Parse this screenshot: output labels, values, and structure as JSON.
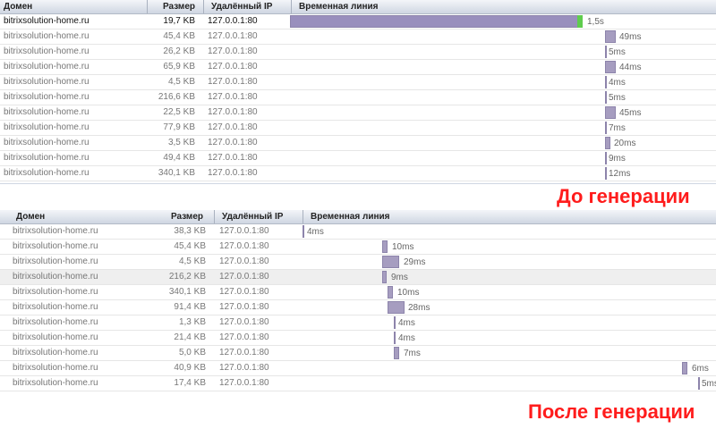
{
  "panel_before": {
    "headers": {
      "domain": "Домен",
      "size": "Размер",
      "ip": "Удалённый IP",
      "timeline": "Временная линия"
    },
    "rows": [
      {
        "domain": "bitrixsolution-home.ru",
        "size": "19,7 KB",
        "ip": "127.0.0.1:80",
        "time": "1,5s"
      },
      {
        "domain": "bitrixsolution-home.ru",
        "size": "45,4 KB",
        "ip": "127.0.0.1:80",
        "time": "49ms"
      },
      {
        "domain": "bitrixsolution-home.ru",
        "size": "26,2 KB",
        "ip": "127.0.0.1:80",
        "time": "5ms"
      },
      {
        "domain": "bitrixsolution-home.ru",
        "size": "65,9 KB",
        "ip": "127.0.0.1:80",
        "time": "44ms"
      },
      {
        "domain": "bitrixsolution-home.ru",
        "size": "4,5 KB",
        "ip": "127.0.0.1:80",
        "time": "4ms"
      },
      {
        "domain": "bitrixsolution-home.ru",
        "size": "216,6 KB",
        "ip": "127.0.0.1:80",
        "time": "5ms"
      },
      {
        "domain": "bitrixsolution-home.ru",
        "size": "22,5 KB",
        "ip": "127.0.0.1:80",
        "time": "45ms"
      },
      {
        "domain": "bitrixsolution-home.ru",
        "size": "77,9 KB",
        "ip": "127.0.0.1:80",
        "time": "7ms"
      },
      {
        "domain": "bitrixsolution-home.ru",
        "size": "3,5 KB",
        "ip": "127.0.0.1:80",
        "time": "20ms"
      },
      {
        "domain": "bitrixsolution-home.ru",
        "size": "49,4 KB",
        "ip": "127.0.0.1:80",
        "time": "9ms"
      },
      {
        "domain": "bitrixsolution-home.ru",
        "size": "340,1 KB",
        "ip": "127.0.0.1:80",
        "time": "12ms"
      }
    ],
    "caption": "До генерации"
  },
  "panel_after": {
    "headers": {
      "domain": "Домен",
      "size": "Размер",
      "ip": "Удалённый IP",
      "timeline": "Временная линия"
    },
    "rows": [
      {
        "domain": "bitrixsolution-home.ru",
        "size": "38,3 KB",
        "ip": "127.0.0.1:80",
        "time": "4ms"
      },
      {
        "domain": "bitrixsolution-home.ru",
        "size": "45,4 KB",
        "ip": "127.0.0.1:80",
        "time": "10ms"
      },
      {
        "domain": "bitrixsolution-home.ru",
        "size": "4,5 KB",
        "ip": "127.0.0.1:80",
        "time": "29ms"
      },
      {
        "domain": "bitrixsolution-home.ru",
        "size": "216,2 KB",
        "ip": "127.0.0.1:80",
        "time": "9ms"
      },
      {
        "domain": "bitrixsolution-home.ru",
        "size": "340,1 KB",
        "ip": "127.0.0.1:80",
        "time": "10ms"
      },
      {
        "domain": "bitrixsolution-home.ru",
        "size": "91,4 KB",
        "ip": "127.0.0.1:80",
        "time": "28ms"
      },
      {
        "domain": "bitrixsolution-home.ru",
        "size": "1,3 KB",
        "ip": "127.0.0.1:80",
        "time": "4ms"
      },
      {
        "domain": "bitrixsolution-home.ru",
        "size": "21,4 KB",
        "ip": "127.0.0.1:80",
        "time": "4ms"
      },
      {
        "domain": "bitrixsolution-home.ru",
        "size": "5,0 KB",
        "ip": "127.0.0.1:80",
        "time": "7ms"
      },
      {
        "domain": "bitrixsolution-home.ru",
        "size": "40,9 KB",
        "ip": "127.0.0.1:80",
        "time": "6ms"
      },
      {
        "domain": "bitrixsolution-home.ru",
        "size": "17,4 KB",
        "ip": "127.0.0.1:80",
        "time": "5ms"
      }
    ],
    "caption": "После генерации"
  },
  "colors": {
    "bar": "#a69dc0",
    "bar_end": "#5fcc4e",
    "caption": "#ff1c1c",
    "header": "#cfd6e2"
  }
}
